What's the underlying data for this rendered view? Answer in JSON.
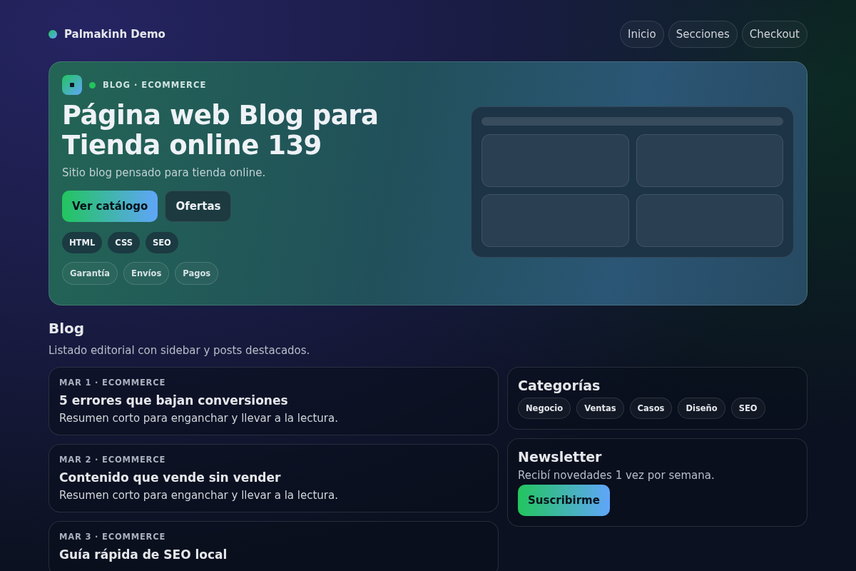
{
  "header": {
    "brand": "Palmakinh Demo",
    "nav": [
      {
        "label": "Inicio"
      },
      {
        "label": "Secciones"
      },
      {
        "label": "Checkout"
      }
    ]
  },
  "hero": {
    "eyebrow": "BLOG · ECOMMERCE",
    "title": "Página web Blog para Tienda online 139",
    "subtitle": "Sitio blog pensado para tienda online.",
    "buttons": [
      {
        "label": "Ver catálogo",
        "kind": "primary"
      },
      {
        "label": "Ofertas",
        "kind": "secondary"
      }
    ],
    "tech_tags": [
      "HTML",
      "CSS",
      "SEO"
    ],
    "feature_tags": [
      "Garantía",
      "Envíos",
      "Pagos"
    ]
  },
  "section": {
    "title": "Blog",
    "subtitle": "Listado editorial con sidebar y posts destacados."
  },
  "posts": [
    {
      "meta": "MAR 1 · ECOMMERCE",
      "title": "5 errores que bajan conversiones",
      "summary": "Resumen corto para enganchar y llevar a la lectura."
    },
    {
      "meta": "MAR 2 · ECOMMERCE",
      "title": "Contenido que vende sin vender",
      "summary": "Resumen corto para enganchar y llevar a la lectura."
    },
    {
      "meta": "MAR 3 · ECOMMERCE",
      "title": "Guía rápida de SEO local"
    }
  ],
  "categories": {
    "title": "Categorías",
    "tags": [
      "Negocio",
      "Ventas",
      "Casos",
      "Diseño",
      "SEO"
    ]
  },
  "newsletter": {
    "title": "Newsletter",
    "text": "Recibí novedades 1 vez por semana.",
    "button": "Suscribirme"
  }
}
